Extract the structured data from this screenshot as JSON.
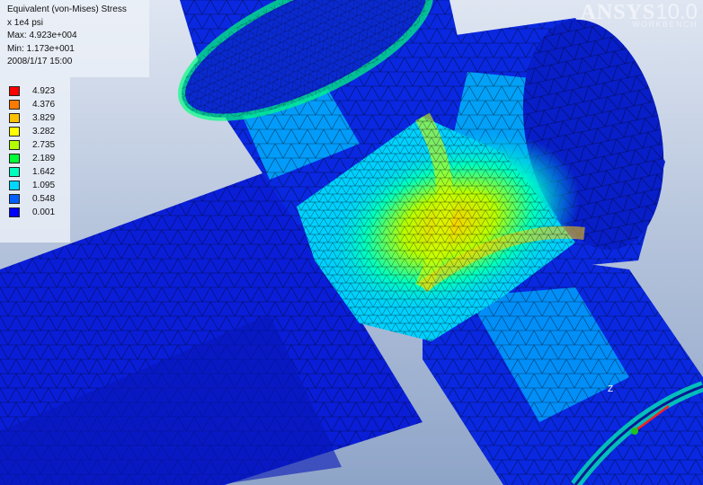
{
  "result": {
    "title": "Equivalent (von-Mises) Stress",
    "units": "x 1e4 psi",
    "max": "Max: 4.923e+004",
    "min": "Min: 1.173e+001",
    "date": "2008/1/17 15:00"
  },
  "legend": [
    {
      "label": "4.923",
      "color": "#ff0000"
    },
    {
      "label": "4.376",
      "color": "#ff7a00"
    },
    {
      "label": "3.829",
      "color": "#ffc000"
    },
    {
      "label": "3.282",
      "color": "#ffff00"
    },
    {
      "label": "2.735",
      "color": "#b4ff00"
    },
    {
      "label": "2.189",
      "color": "#00ff36"
    },
    {
      "label": "1.642",
      "color": "#00ffbe"
    },
    {
      "label": "1.095",
      "color": "#00d6ff"
    },
    {
      "label": "0.548",
      "color": "#0060ff"
    },
    {
      "label": "0.001",
      "color": "#0000ff"
    }
  ],
  "brand": {
    "name": "ANSYS",
    "version": "10.0",
    "sub": "WORKBENCH"
  },
  "triad": {
    "label": "Z",
    "x_color": "#ff2020",
    "y_color": "#20c020"
  }
}
